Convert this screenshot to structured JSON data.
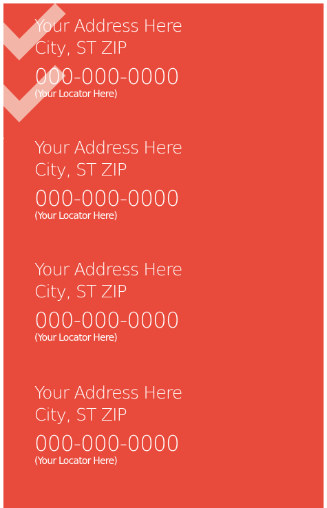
{
  "colors": {
    "background": "#e84a3b",
    "text": "#ffffff",
    "accent_check": "#f6c8bd"
  },
  "icons": {
    "decoration": "checkmark-icon"
  },
  "locations": [
    {
      "address": "Your Address Here",
      "city": "City, ST ZIP",
      "phone": "000-000-0000",
      "locator": "(Your Locator Here)"
    },
    {
      "address": "Your Address Here",
      "city": "City, ST ZIP",
      "phone": "000-000-0000",
      "locator": "(Your Locator Here)"
    },
    {
      "address": "Your Address Here",
      "city": "City, ST ZIP",
      "phone": "000-000-0000",
      "locator": "(Your Locator Here)"
    },
    {
      "address": "Your Address Here",
      "city": "City, ST ZIP",
      "phone": "000-000-0000",
      "locator": "(Your Locator Here)"
    }
  ]
}
